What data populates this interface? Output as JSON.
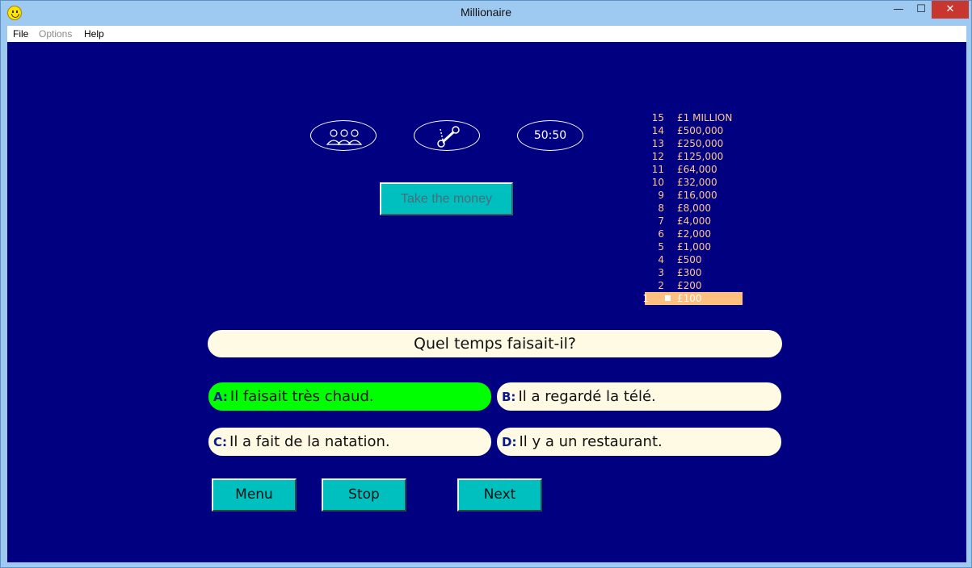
{
  "window": {
    "title": "Millionaire",
    "icon": "smiley-icon"
  },
  "menu": {
    "file": "File",
    "options": "Options",
    "help": "Help"
  },
  "lifelines": {
    "audience_icon": "audience-icon",
    "phone_icon": "phone-icon",
    "fifty_fifty": "50:50"
  },
  "take_money": "Take the money",
  "ladder": [
    {
      "level": "15",
      "amount": "£1 MILLION"
    },
    {
      "level": "14",
      "amount": "£500,000"
    },
    {
      "level": "13",
      "amount": "£250,000"
    },
    {
      "level": "12",
      "amount": "£125,000"
    },
    {
      "level": "11",
      "amount": "£64,000"
    },
    {
      "level": "10",
      "amount": "£32,000"
    },
    {
      "level": "9",
      "amount": "£16,000"
    },
    {
      "level": "8",
      "amount": "£8,000"
    },
    {
      "level": "7",
      "amount": "£4,000"
    },
    {
      "level": "6",
      "amount": "£2,000"
    },
    {
      "level": "5",
      "amount": "£1,000"
    },
    {
      "level": "4",
      "amount": "£500"
    },
    {
      "level": "3",
      "amount": "£300"
    },
    {
      "level": "2",
      "amount": "£200"
    },
    {
      "level": "1",
      "amount": "£100"
    }
  ],
  "current_level": "1",
  "question": "Quel temps faisait-il?",
  "answers": {
    "a": {
      "letter": "A:",
      "text": "Il faisait très chaud."
    },
    "b": {
      "letter": "B:",
      "text": "Il a regardé la télé."
    },
    "c": {
      "letter": "C:",
      "text": "Il a fait de la natation."
    },
    "d": {
      "letter": "D:",
      "text": "Il y a un restaurant."
    }
  },
  "buttons": {
    "menu": "Menu",
    "stop": "Stop",
    "next": "Next"
  },
  "colors": {
    "stage": "#000080",
    "selected_answer": "#00ff00",
    "button": "#00bfbf",
    "ladder_text": "#ffc88c",
    "ladder_current": "#ffc080"
  }
}
